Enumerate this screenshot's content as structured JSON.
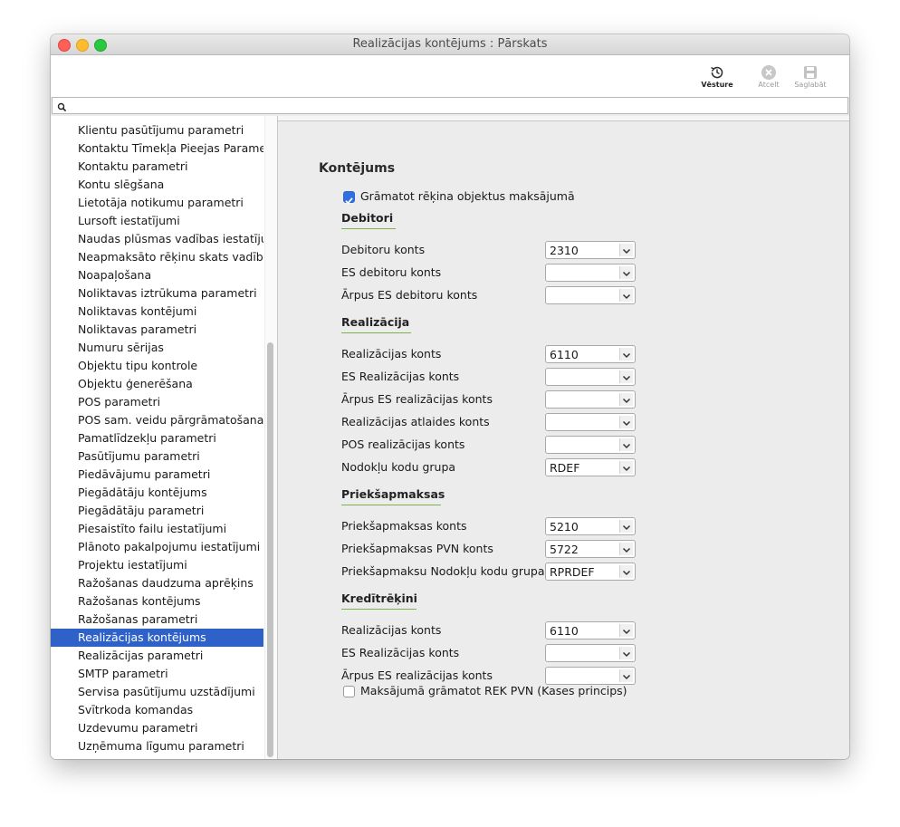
{
  "window": {
    "title": "Realizācijas kontējums : Pārskats"
  },
  "toolbar": {
    "history_label": "Vēsture",
    "cancel_label": "Atcelt",
    "save_label": "Saglabāt"
  },
  "search": {
    "value": ""
  },
  "sidebar": {
    "items": [
      "Klientu pasūtījumu parametri",
      "Kontaktu Tīmekļa Pieejas Parametri",
      "Kontaktu parametri",
      "Kontu slēgšana",
      "Lietotāja notikumu parametri",
      "Lursoft iestatījumi",
      "Naudas plūsmas vadības iestatījumi",
      "Neapmaksāto rēķinu skats vadībai",
      "Noapaļošana",
      "Noliktavas iztrūkuma parametri",
      "Noliktavas kontējumi",
      "Noliktavas parametri",
      "Numuru sērijas",
      "Objektu tipu kontrole",
      "Objektu ģenerēšana",
      "POS parametri",
      "POS sam. veidu pārgrāmatošana",
      "Pamatlīdzekļu parametri",
      "Pasūtījumu parametri",
      "Piedāvājumu parametri",
      "Piegādātāju kontējums",
      "Piegādātāju parametri",
      "Piesaistīto failu iestatījumi",
      "Plānoto pakalpojumu iestatījumi",
      "Projektu iestatījumi",
      "Ražošanas daudzuma aprēķins",
      "Ražošanas kontējums",
      "Ražošanas parametri",
      "Realizācijas kontējums",
      "Realizācijas parametri",
      "SMTP parametri",
      "Servisa pasūtījumu uzstādījumi",
      "Svītrkoda komandas",
      "Uzdevumu parametri",
      "Uzņēmuma līgumu parametri"
    ],
    "selected_index": 28
  },
  "main": {
    "title": "Kontējums",
    "checkbox_top": {
      "label": "Grāmatot rēķina objektus maksājumā",
      "checked": true
    },
    "sections": [
      {
        "title": "Debitori",
        "rows": [
          {
            "label": "Debitoru konts",
            "value": "2310"
          },
          {
            "label": "ES debitoru konts",
            "value": ""
          },
          {
            "label": "Ārpus ES debitoru konts",
            "value": ""
          }
        ]
      },
      {
        "title": "Realizācija",
        "rows": [
          {
            "label": "Realizācijas konts",
            "value": "6110"
          },
          {
            "label": "ES Realizācijas konts",
            "value": ""
          },
          {
            "label": "Ārpus ES realizācijas konts",
            "value": ""
          },
          {
            "label": "Realizācijas atlaides konts",
            "value": ""
          },
          {
            "label": "POS realizācijas konts",
            "value": ""
          },
          {
            "label": "Nodokļu kodu grupa",
            "value": "RDEF"
          }
        ]
      },
      {
        "title": "Priekšapmaksas",
        "rows": [
          {
            "label": "Priekšapmaksas konts",
            "value": "5210"
          },
          {
            "label": "Priekšapmaksas PVN konts",
            "value": "5722"
          },
          {
            "label": "Priekšapmaksu Nodokļu kodu grupa",
            "value": "RPRDEF"
          }
        ]
      },
      {
        "title": "Kredītrēķini",
        "rows": [
          {
            "label": "Realizācijas konts",
            "value": "6110"
          },
          {
            "label": "ES Realizācijas konts",
            "value": ""
          },
          {
            "label": "Ārpus ES realizācijas konts",
            "value": ""
          }
        ]
      }
    ],
    "checkbox_bottom": {
      "label": "Maksājumā grāmatot REK PVN (Kases princips)",
      "checked": false
    }
  }
}
